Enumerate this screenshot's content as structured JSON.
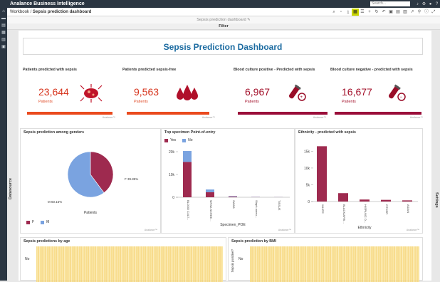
{
  "app": {
    "brand": "Analance Business Intelligence",
    "search_placeholder": "Search..."
  },
  "toolbar": {
    "crumb_root": "Workbook",
    "crumb_current": "Sepsis prediction dashboard"
  },
  "subbar": {
    "title": "Sepsis prediction dashboard"
  },
  "filter": {
    "label": "Filter"
  },
  "side": {
    "datasource": "Datasource",
    "settings": "Settings"
  },
  "dashboard": {
    "title": "Sepsis Prediction Dashboard"
  },
  "kpis": [
    {
      "title": "Patients predicted with sepsis",
      "value": "23,644",
      "label": "Patients",
      "icon": "bacteria-icon"
    },
    {
      "title": "Patients predicted sepsis-free",
      "value": "9,563",
      "label": "Patients",
      "icon": "blood-drops-icon"
    },
    {
      "title": "Blood culture positive - Predicted with sepsis",
      "value": "6,967",
      "label": "Patients",
      "icon": "test-tube-icon"
    },
    {
      "title": "Blood culture negative - predicted with sepsis",
      "value": "16,677",
      "label": "Patients",
      "icon": "test-tube-icon"
    }
  ],
  "analyzer_tag": "Analance™",
  "colors": {
    "red": "#a3102a",
    "orange": "#d7351e",
    "maroon": "#9e2a4f",
    "blue": "#7aa3e0",
    "title_blue": "#1a6aa0",
    "heat": "#f5d36a"
  },
  "panels": {
    "gender": {
      "title": "Sepsis prediction among genders",
      "x_label": "Patients",
      "legend": [
        "F",
        "M"
      ]
    },
    "specimen": {
      "title": "Top specimen Point-of-entry",
      "legend": [
        "Yes",
        "No"
      ],
      "x_label": "Specimen_POE"
    },
    "ethnicity": {
      "title": "Ethnicity - predicted with sepsis",
      "x_label": "Ethnicity"
    },
    "age": {
      "title": "Sepsis predictions by age",
      "y_tick": "No"
    },
    "bmi": {
      "title": "Sepsis prediction by BMI",
      "y_label": "Sepsis positive?"
    }
  },
  "chart_data": [
    {
      "type": "pie",
      "categories": [
        "F",
        "M"
      ],
      "values": [
        39.85,
        60.15
      ],
      "labels": [
        "F 39.85%",
        "M 60.15%"
      ]
    },
    {
      "type": "bar",
      "categories": [
        "BLOOD CULT...",
        "MRSA SCREE...",
        "SWAB",
        "Staph aureu...",
        "TISSUE"
      ],
      "series": [
        {
          "name": "Yes",
          "values": [
            15500,
            2200,
            300,
            100,
            50
          ]
        },
        {
          "name": "No",
          "values": [
            4800,
            1200,
            200,
            80,
            40
          ]
        }
      ],
      "ylim": [
        0,
        20000
      ],
      "yticks": [
        "0",
        "10k",
        "20k"
      ]
    },
    {
      "type": "bar",
      "categories": [
        "WHITE",
        "BLACK/AFRI...",
        "HISPANIC O...",
        "OTHER",
        "ASIAN"
      ],
      "values": [
        16500,
        2500,
        600,
        500,
        350
      ],
      "ylim": [
        0,
        17000
      ],
      "yticks": [
        "0",
        "5k",
        "10k",
        "15k"
      ]
    }
  ]
}
